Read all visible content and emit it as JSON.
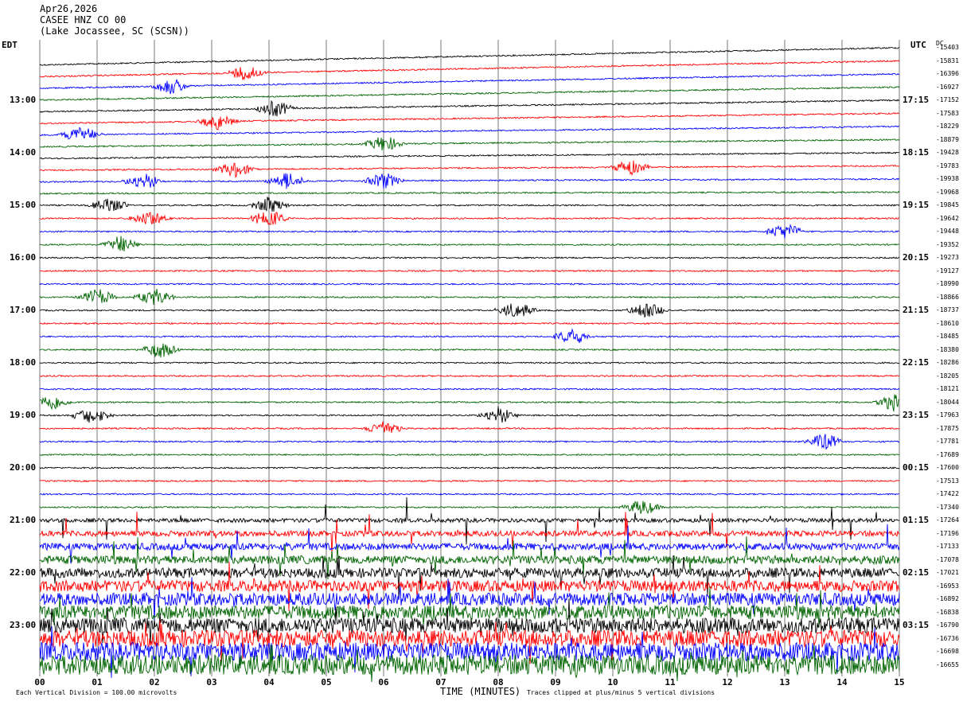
{
  "header": {
    "date": "Apr26,2026",
    "station": "CASEE HNZ CO 00",
    "location": "(Lake Jocassee, SC (SCSN))"
  },
  "left_tz": "EDT",
  "right_tz": "UTC",
  "dc_label": "DC",
  "footer": {
    "scale": "Each Vertical Division = 100.00 microvolts",
    "xlabel": "TIME (MINUTES)",
    "clip": "Traces clipped at plus/minus 5 vertical divisions"
  },
  "chart_data": {
    "type": "line",
    "title": "CASEE HNZ CO 00",
    "xlabel": "TIME (MINUTES)",
    "x_ticks": [
      "00",
      "01",
      "02",
      "03",
      "04",
      "05",
      "06",
      "07",
      "08",
      "09",
      "10",
      "11",
      "12",
      "13",
      "14",
      "15"
    ],
    "xlim": [
      0,
      15
    ],
    "trace_colors": [
      "#000000",
      "#ff0000",
      "#0000ff",
      "#006400"
    ],
    "left_hour_labels": [
      {
        "trace": 4,
        "label": "13:00"
      },
      {
        "trace": 8,
        "label": "14:00"
      },
      {
        "trace": 12,
        "label": "15:00"
      },
      {
        "trace": 16,
        "label": "16:00"
      },
      {
        "trace": 20,
        "label": "17:00"
      },
      {
        "trace": 24,
        "label": "18:00"
      },
      {
        "trace": 28,
        "label": "19:00"
      },
      {
        "trace": 32,
        "label": "20:00"
      },
      {
        "trace": 36,
        "label": "21:00"
      },
      {
        "trace": 40,
        "label": "22:00"
      },
      {
        "trace": 44,
        "label": "23:00"
      }
    ],
    "right_hour_labels": [
      {
        "trace": 4,
        "label": "17:15"
      },
      {
        "trace": 8,
        "label": "18:15"
      },
      {
        "trace": 12,
        "label": "19:15"
      },
      {
        "trace": 16,
        "label": "20:15"
      },
      {
        "trace": 20,
        "label": "21:15"
      },
      {
        "trace": 24,
        "label": "22:15"
      },
      {
        "trace": 28,
        "label": "23:15"
      },
      {
        "trace": 32,
        "label": "00:15"
      },
      {
        "trace": 36,
        "label": "01:15"
      },
      {
        "trace": 40,
        "label": "02:15"
      },
      {
        "trace": 44,
        "label": "03:15"
      }
    ],
    "dc_offsets": [
      -15403,
      -15831,
      -16396,
      -16927,
      -17152,
      -17583,
      -18229,
      -18879,
      -19428,
      -19783,
      -19938,
      -19968,
      -19845,
      -19642,
      -19448,
      -19352,
      -19273,
      -19127,
      -18990,
      -18866,
      -18737,
      -18610,
      -18485,
      -18380,
      -18286,
      -18205,
      -18121,
      -18044,
      -17963,
      -17875,
      -17781,
      -17689,
      -17600,
      -17513,
      -17422,
      -17340,
      -17264,
      -17196,
      -17133,
      -17078,
      -17021,
      -16953,
      -16892,
      -16838,
      -16790,
      -16736,
      -16698,
      -16655
    ],
    "events": [
      {
        "trace": 1,
        "minute": 3.6
      },
      {
        "trace": 2,
        "minute": 2.3
      },
      {
        "trace": 4,
        "minute": 4.1
      },
      {
        "trace": 5,
        "minute": 3.1
      },
      {
        "trace": 6,
        "minute": 0.7
      },
      {
        "trace": 7,
        "minute": 6.0
      },
      {
        "trace": 9,
        "minute": 3.4
      },
      {
        "trace": 9,
        "minute": 10.3
      },
      {
        "trace": 10,
        "minute": 1.8
      },
      {
        "trace": 10,
        "minute": 4.3
      },
      {
        "trace": 10,
        "minute": 6.0
      },
      {
        "trace": 12,
        "minute": 1.2
      },
      {
        "trace": 12,
        "minute": 4.0
      },
      {
        "trace": 13,
        "minute": 1.9
      },
      {
        "trace": 13,
        "minute": 4.0
      },
      {
        "trace": 14,
        "minute": 13.0
      },
      {
        "trace": 15,
        "minute": 1.4
      },
      {
        "trace": 19,
        "minute": 1.0
      },
      {
        "trace": 19,
        "minute": 2.0
      },
      {
        "trace": 20,
        "minute": 8.3
      },
      {
        "trace": 20,
        "minute": 10.6
      },
      {
        "trace": 22,
        "minute": 9.3
      },
      {
        "trace": 23,
        "minute": 2.1
      },
      {
        "trace": 27,
        "minute": 0.2
      },
      {
        "trace": 27,
        "minute": 14.9
      },
      {
        "trace": 28,
        "minute": 0.9
      },
      {
        "trace": 28,
        "minute": 8.0
      },
      {
        "trace": 29,
        "minute": 6.0
      },
      {
        "trace": 30,
        "minute": 13.7
      },
      {
        "trace": 35,
        "minute": 10.5
      }
    ],
    "noisy_from_trace": 36
  }
}
